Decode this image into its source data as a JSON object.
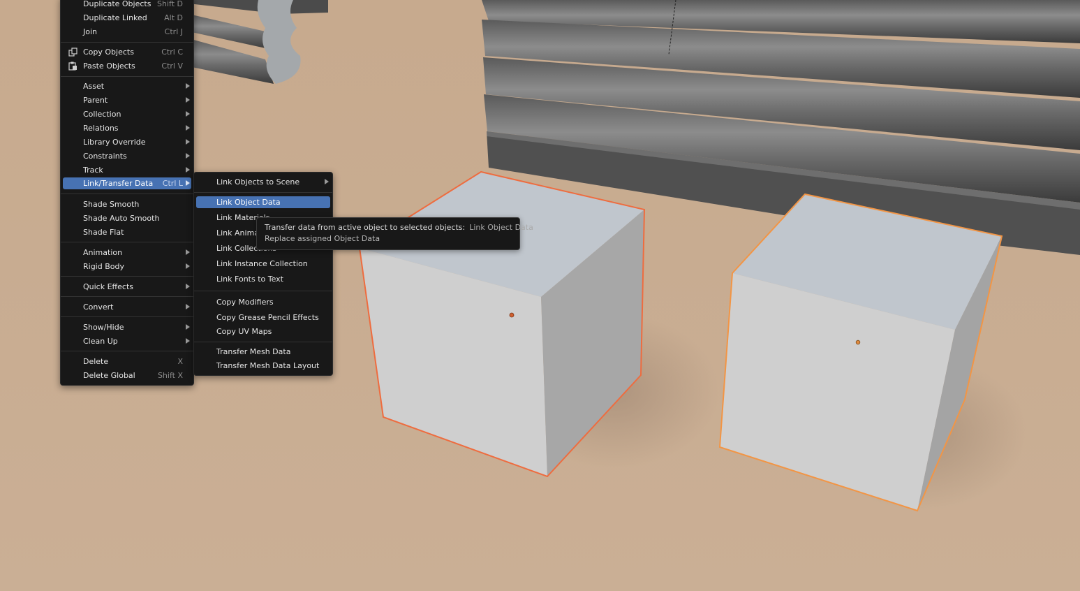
{
  "object_menu": {
    "items": [
      {
        "label": "Duplicate Objects",
        "shortcut": "Shift D"
      },
      {
        "label": "Duplicate Linked",
        "shortcut": "Alt D"
      },
      {
        "label": "Join",
        "shortcut": "Ctrl J"
      },
      {
        "label": "Copy Objects",
        "shortcut": "Ctrl C",
        "icon": "copy-icon"
      },
      {
        "label": "Paste Objects",
        "shortcut": "Ctrl V",
        "icon": "paste-icon"
      },
      {
        "label": "Asset",
        "submenu": true
      },
      {
        "label": "Parent",
        "submenu": true
      },
      {
        "label": "Collection",
        "submenu": true
      },
      {
        "label": "Relations",
        "submenu": true
      },
      {
        "label": "Library Override",
        "submenu": true
      },
      {
        "label": "Constraints",
        "submenu": true
      },
      {
        "label": "Track",
        "submenu": true
      },
      {
        "label": "Link/Transfer Data",
        "shortcut": "Ctrl L",
        "submenu": true,
        "active": true
      },
      {
        "label": "Shade Smooth"
      },
      {
        "label": "Shade Auto Smooth"
      },
      {
        "label": "Shade Flat"
      },
      {
        "label": "Animation",
        "submenu": true
      },
      {
        "label": "Rigid Body",
        "submenu": true
      },
      {
        "label": "Quick Effects",
        "submenu": true
      },
      {
        "label": "Convert",
        "submenu": true
      },
      {
        "label": "Show/Hide",
        "submenu": true
      },
      {
        "label": "Clean Up",
        "submenu": true
      },
      {
        "label": "Delete",
        "shortcut": "X"
      },
      {
        "label": "Delete Global",
        "shortcut": "Shift X"
      }
    ]
  },
  "link_menu": {
    "items": [
      {
        "label": "Link Objects to Scene",
        "submenu": true
      },
      {
        "label": "Link Object Data",
        "active": true
      },
      {
        "label": "Link Materials"
      },
      {
        "label": "Link Animation Data"
      },
      {
        "label": "Link Collections"
      },
      {
        "label": "Link Instance Collection"
      },
      {
        "label": "Link Fonts to Text"
      },
      {
        "label": "Copy Modifiers"
      },
      {
        "label": "Copy Grease Pencil Effects"
      },
      {
        "label": "Copy UV Maps"
      },
      {
        "label": "Transfer Mesh Data"
      },
      {
        "label": "Transfer Mesh Data Layout"
      }
    ]
  },
  "tooltip": {
    "description": "Transfer data from active object to selected objects:",
    "operator": "Link Object Data",
    "detail": "Replace assigned Object Data"
  },
  "colors": {
    "menu_bg": "#181818",
    "highlight": "#4772b3",
    "floor": "#c8ad92",
    "cube_face": "#d0d0d0",
    "active_outline": "#f0783c",
    "selected_outline": "#f39a48"
  }
}
